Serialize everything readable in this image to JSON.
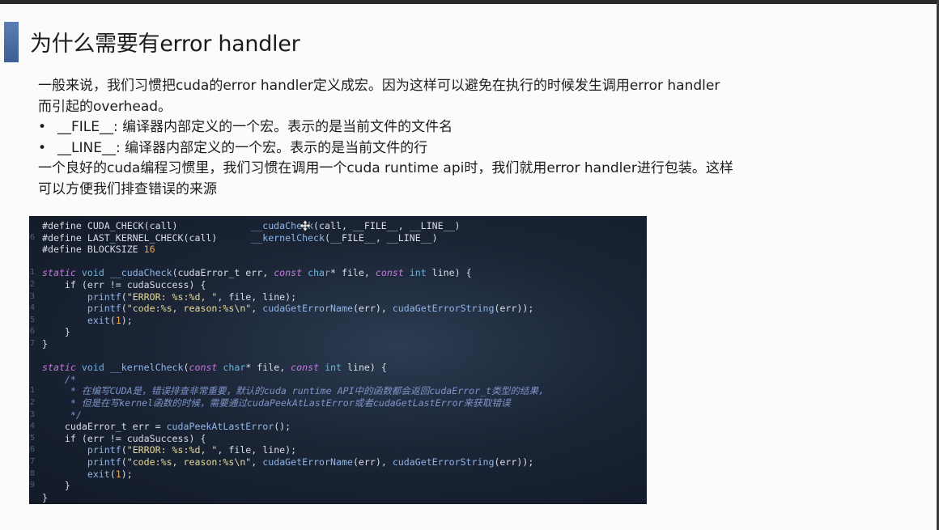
{
  "slide": {
    "title": "为什么需要有error handler",
    "para1_line1": "一般来说，我们习惯把cuda的error handler定义成宏。因为这样可以避免在执行的时候发生调用error handler",
    "para1_line2": "而引起的overhead。",
    "bullet_symbol": "•",
    "bullet1": "__FILE__: 编译器内部定义的一个宏。表示的是当前文件的文件名",
    "bullet2": "__LINE__: 编译器内部定义的一个宏。表示的是当前文件的行",
    "para2_line1": "一个良好的cuda编程习惯里，我们习惯在调用一个cuda runtime api时，我们就用error handler进行包装。这样",
    "para2_line2": "可以方便我们排查错误的来源"
  },
  "code": {
    "line_numbers": [
      "",
      "6",
      "",
      "",
      "1",
      "2",
      "3",
      "4",
      "5",
      "6",
      "7",
      "",
      "",
      "",
      "1",
      "2",
      "3",
      "4",
      "5",
      "6",
      "7",
      "8",
      "9",
      "",
      ""
    ],
    "lines": [
      "#define CUDA_CHECK(call)             __cudaCheck(call, __FILE__, __LINE__)",
      "#define LAST_KERNEL_CHECK(call)      __kernelCheck(__FILE__, __LINE__)",
      "#define BLOCKSIZE 16",
      "",
      "static void __cudaCheck(cudaError_t err, const char* file, const int line) {",
      "    if (err != cudaSuccess) {",
      "        printf(\"ERROR: %s:%d, \", file, line);",
      "        printf(\"code:%s, reason:%s\\n\", cudaGetErrorName(err), cudaGetErrorString(err));",
      "        exit(1);",
      "    }",
      "}",
      "",
      "static void __kernelCheck(const char* file, const int line) {",
      "    /*",
      "     * 在编写CUDA是，错误排查非常重要，默认的cuda runtime API中的函数都会返回cudaError_t类型的结果，",
      "     * 但是在写kernel函数的时候，需要通过cudaPeekAtLastError或者cudaGetLastError来获取错误",
      "     */",
      "    cudaError_t err = cudaPeekAtLastError();",
      "    if (err != cudaSuccess) {",
      "        printf(\"ERROR: %s:%d, \", file, line);",
      "        printf(\"code:%s, reason:%s\\n\", cudaGetErrorName(err), cudaGetErrorString(err));",
      "        exit(1);",
      "    }",
      "}"
    ]
  },
  "colors": {
    "accent": "#4a6fa5",
    "code_bg": "#1b2536"
  }
}
